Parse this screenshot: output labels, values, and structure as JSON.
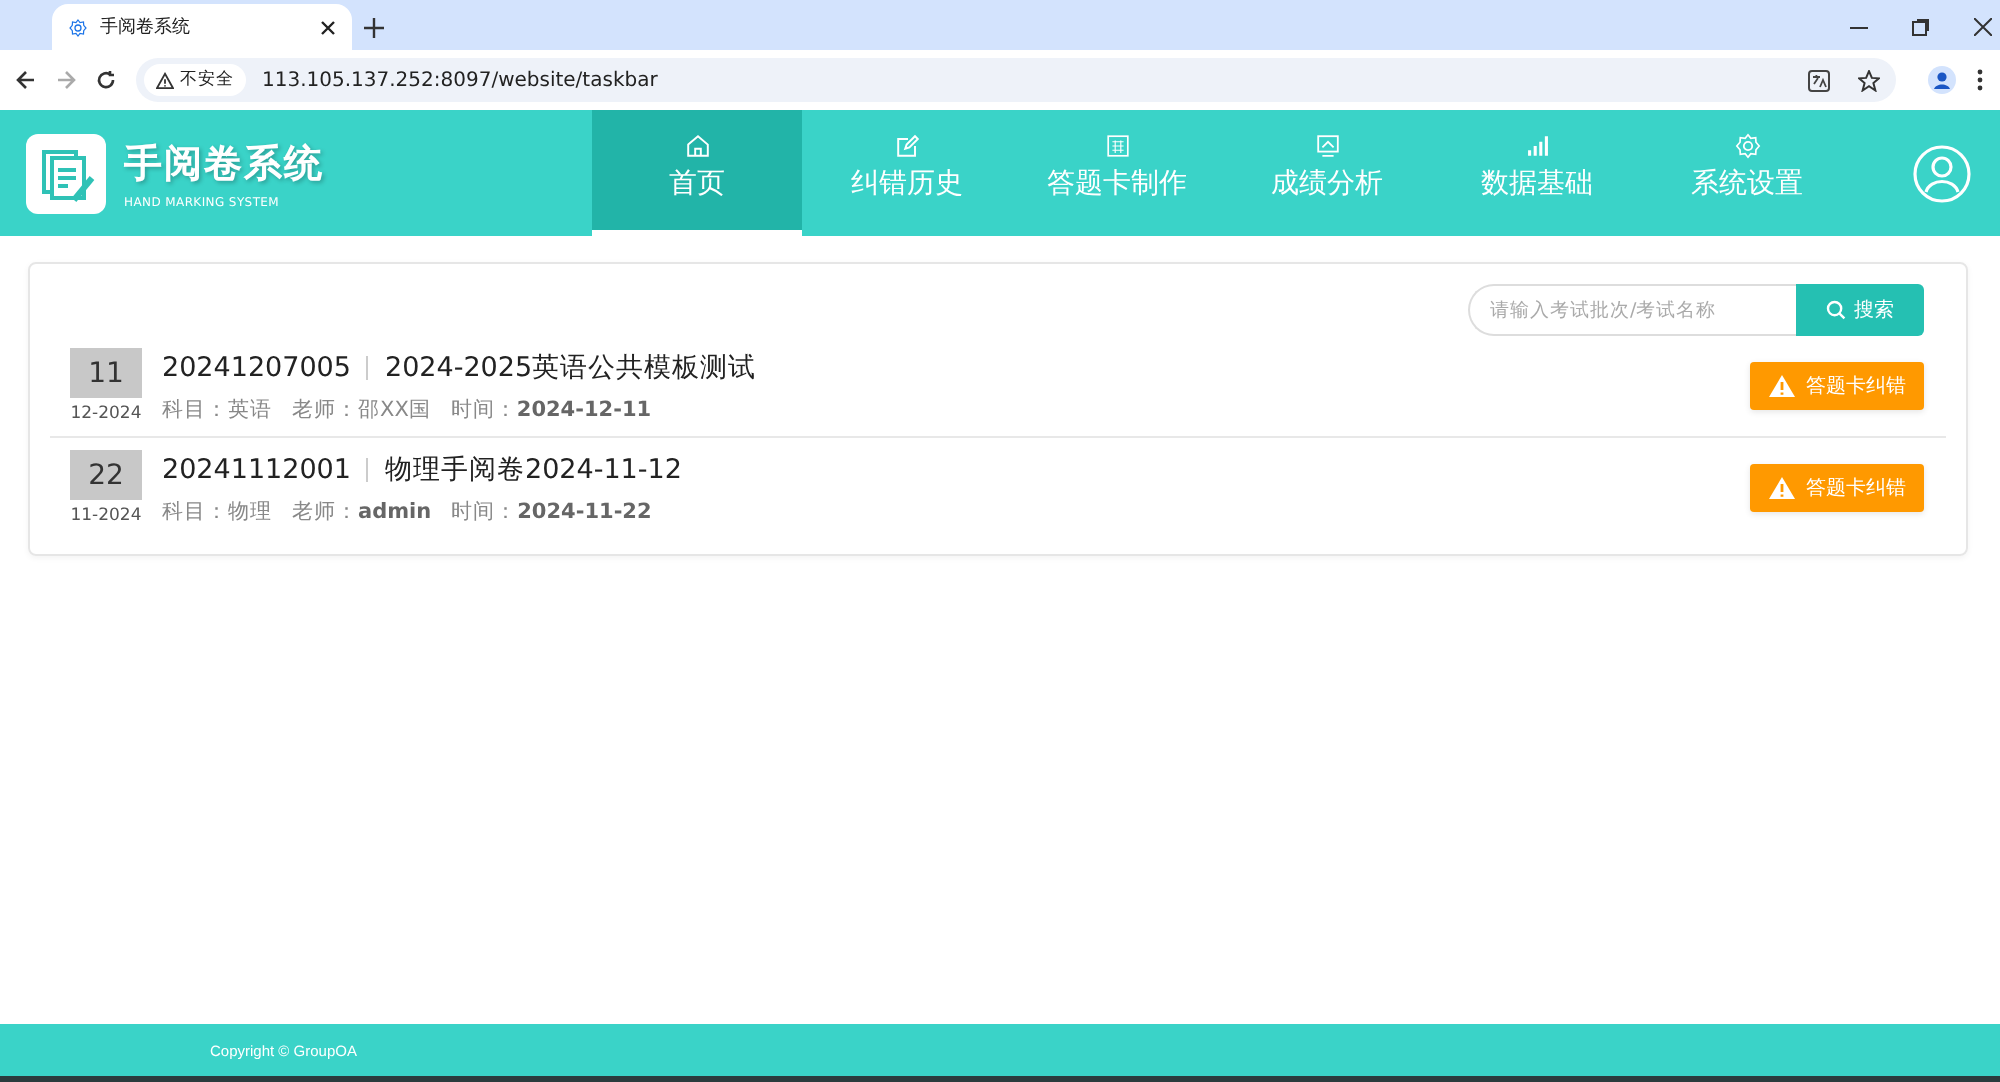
{
  "browser": {
    "tab_title": "手阅卷系统",
    "security_label": "不安全",
    "url": "113.105.137.252:8097/website/taskbar"
  },
  "header": {
    "logo_title": "手阅卷系统",
    "logo_subtitle": "HAND MARKING SYSTEM",
    "nav": [
      {
        "label": "首页",
        "selected": true
      },
      {
        "label": "纠错历史",
        "selected": false
      },
      {
        "label": "答题卡制作",
        "selected": false
      },
      {
        "label": "成绩分析",
        "selected": false
      },
      {
        "label": "数据基础",
        "selected": false
      },
      {
        "label": "系统设置",
        "selected": false
      }
    ]
  },
  "search": {
    "placeholder": "请输入考试批次/考试名称",
    "button": "搜索"
  },
  "exams": [
    {
      "day": "11",
      "month": "12-2024",
      "batch": "20241207005",
      "name": "2024-2025英语公共模板测试",
      "meta": [
        "科目：英语",
        "老师：邵XX国",
        "时间：**2024-12-11**"
      ],
      "action": "答题卡纠错"
    },
    {
      "day": "22",
      "month": "11-2024",
      "batch": "20241112001",
      "name": "物理手阅卷2024-11-12",
      "meta": [
        "科目：物理",
        "老师：**admin**",
        "时间：**2024-11-22**"
      ],
      "action": "答题卡纠错"
    }
  ],
  "footer": {
    "copyright": "Copyright © GroupOA"
  }
}
